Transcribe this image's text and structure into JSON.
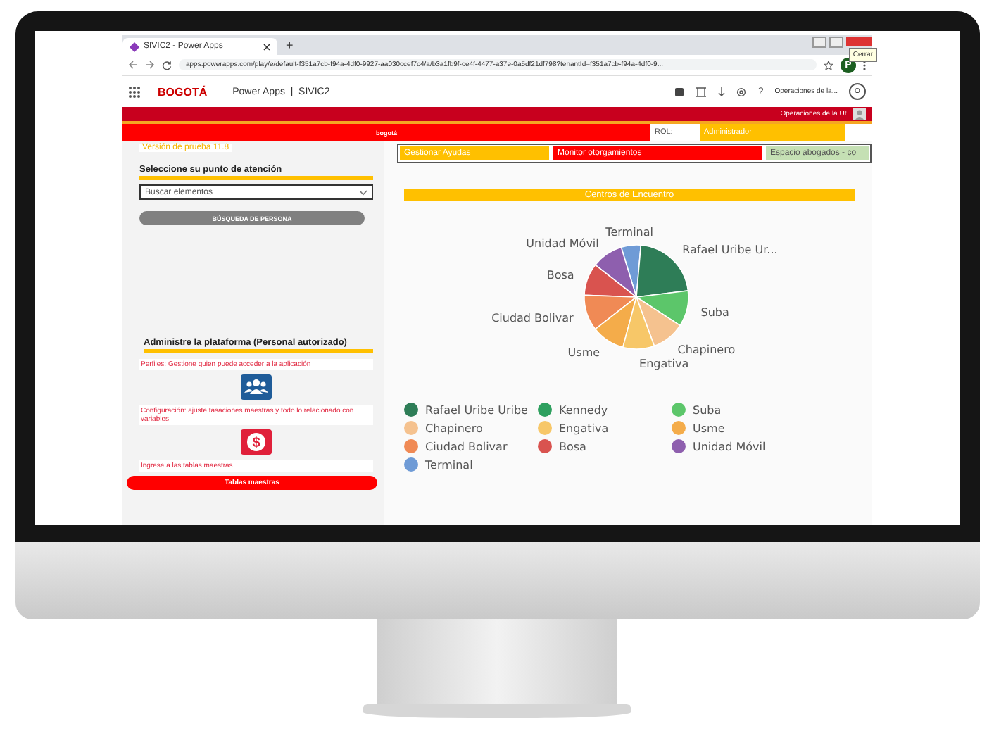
{
  "browser": {
    "tab_title": "SIVIC2 - Power Apps",
    "new_tab": "+",
    "url": "apps.powerapps.com/play/e/default-f351a7cb-f94a-4df0-9927-aa030ccef7c4/a/b3a1fb9f-ce4f-4477-a37e-0a5df21df798?tenantId=f351a7cb-f94a-4df0-9...",
    "tooltip": "Cerrar",
    "profile": "P"
  },
  "app_header": {
    "logo": "BOGOTÁ",
    "title": "Power Apps  |  SIVIC2",
    "help": "?",
    "user": "Operaciones de la...",
    "avatar": "O"
  },
  "top_bar": {
    "user": "Operaciones de la Ut.."
  },
  "banner": {
    "logo": "bogotá",
    "role_label": "ROL:",
    "role": "Administrador"
  },
  "sidebar": {
    "version": "Versión de prueba 11.8",
    "select_heading": "Seleccione su punto de atención",
    "dropdown": {
      "placeholder": "Buscar elementos"
    },
    "search_button": "BÚSQUEDA DE PERSONA",
    "admin_heading": "Administre la plataforma (Personal autorizado)",
    "items": [
      {
        "kind": "people",
        "text": "Perfiles: Gestione quien puede acceder a la aplicación"
      },
      {
        "kind": "money",
        "glyph": "$",
        "text": "Configuración: ajuste tasaciones maestras y todo lo relacionado con variables"
      },
      {
        "kind": "button",
        "text": "Ingrese a las tablas maestras",
        "button": "Tablas maestras"
      }
    ]
  },
  "tabs": [
    {
      "label": "Gestionar Ayudas",
      "color": "#ffc000"
    },
    {
      "label": "Monitor otorgamientos",
      "color": "#ff0000"
    },
    {
      "label": "Espacio abogados - co",
      "color": "#c5e0b4"
    }
  ],
  "chart": {
    "title": "Centros de Encuentro",
    "slices": [
      {
        "label": "Terminal",
        "color": "#6f9bd6"
      },
      {
        "label": "Unidad Móvil",
        "color": "#8e5fae"
      },
      {
        "label": "Rafael Uribe Ur...",
        "color": "#2e7d57"
      },
      {
        "label": "Bosa",
        "color": "#d9534f"
      },
      {
        "label": "Suba",
        "color": "#5cc66a"
      },
      {
        "label": "Ciudad Bolivar",
        "color": "#f08a55"
      },
      {
        "label": "Chapinero",
        "color": "#f5c28f"
      },
      {
        "label": "Usme",
        "color": "#f4ac4a"
      },
      {
        "label": "Engativa",
        "color": "#f7c768"
      }
    ],
    "legend": [
      {
        "label": "Rafael Uribe Uribe",
        "color": "#2e7d57"
      },
      {
        "label": "Kennedy",
        "color": "#2ea05f"
      },
      {
        "label": "Suba",
        "color": "#5cc66a"
      },
      {
        "label": "Chapinero",
        "color": "#f5c28f"
      },
      {
        "label": "Engativa",
        "color": "#f7c768"
      },
      {
        "label": "Usme",
        "color": "#f4ac4a"
      },
      {
        "label": "Ciudad Bolivar",
        "color": "#f08a55"
      },
      {
        "label": "Bosa",
        "color": "#d9534f"
      },
      {
        "label": "Unidad Móvil",
        "color": "#8e5fae"
      },
      {
        "label": "Terminal",
        "color": "#6f9bd6"
      }
    ]
  }
}
